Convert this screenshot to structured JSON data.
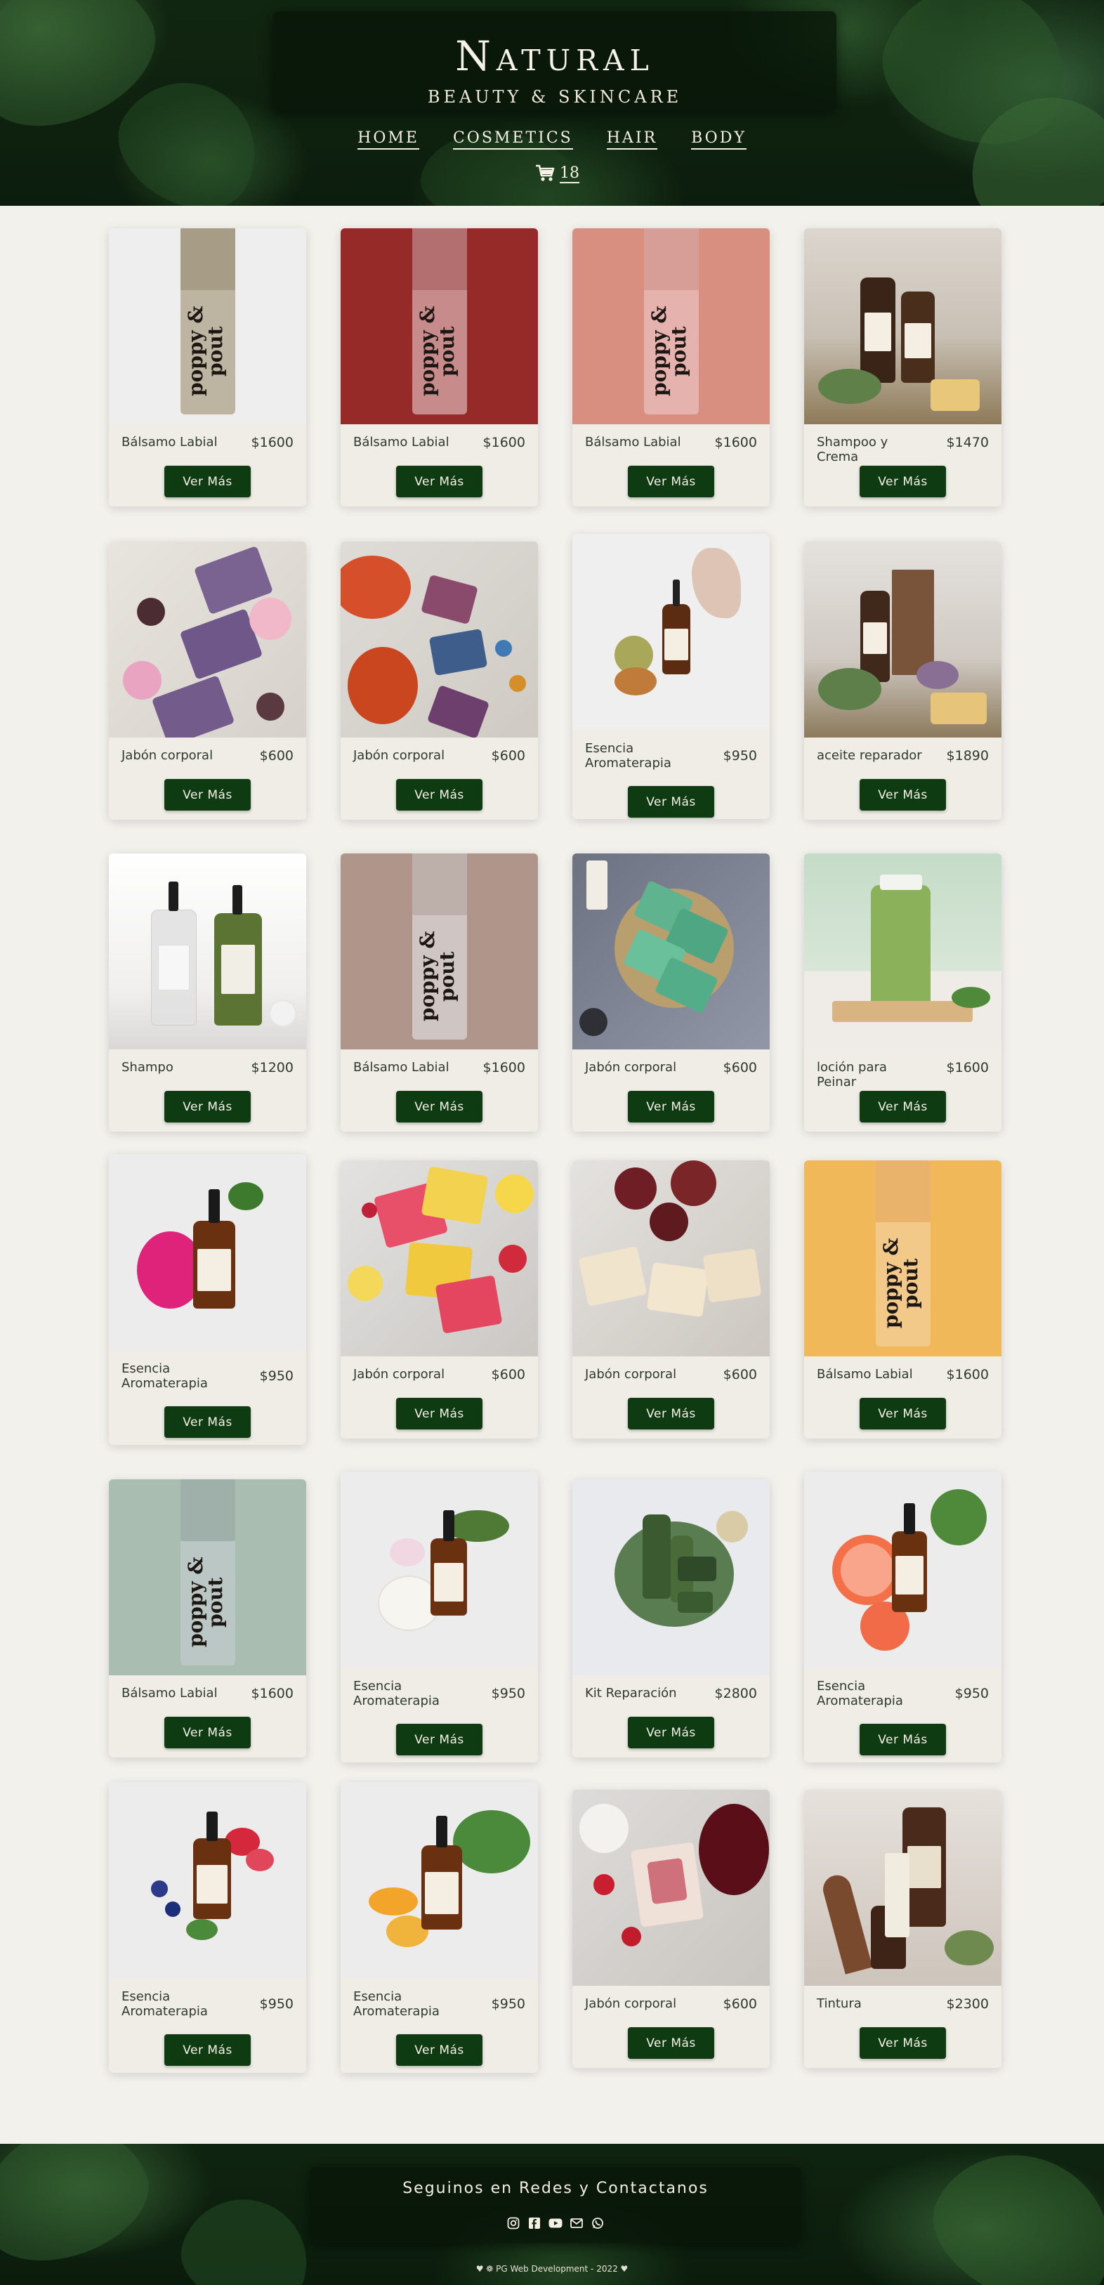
{
  "brand": {
    "title": "Natural",
    "subtitle": "Beauty & Skincare"
  },
  "nav": [
    "Home",
    "Cosmetics",
    "Hair",
    "Body"
  ],
  "cart": {
    "count": "18"
  },
  "button_label": "Ver Más",
  "products": [
    {
      "name": "Bálsamo Labial",
      "price": "$1600"
    },
    {
      "name": "Bálsamo Labial",
      "price": "$1600"
    },
    {
      "name": "Bálsamo Labial",
      "price": "$1600"
    },
    {
      "name": "Shampoo y Crema",
      "price": "$1470"
    },
    {
      "name": "Jabón corporal",
      "price": "$600"
    },
    {
      "name": "Jabón corporal",
      "price": "$600"
    },
    {
      "name": "Esencia Aromaterapia",
      "price": "$950"
    },
    {
      "name": "aceite reparador",
      "price": "$1890"
    },
    {
      "name": "Shampo",
      "price": "$1200"
    },
    {
      "name": "Bálsamo Labial",
      "price": "$1600"
    },
    {
      "name": "Jabón corporal",
      "price": "$600"
    },
    {
      "name": "loción para Peinar",
      "price": "$1600"
    },
    {
      "name": "Esencia Aromaterapia",
      "price": "$950"
    },
    {
      "name": "Jabón corporal",
      "price": "$600"
    },
    {
      "name": "Jabón corporal",
      "price": "$600"
    },
    {
      "name": "Bálsamo Labial",
      "price": "$1600"
    },
    {
      "name": "Bálsamo Labial",
      "price": "$1600"
    },
    {
      "name": "Esencia Aromaterapia",
      "price": "$950"
    },
    {
      "name": "Kit Reparación",
      "price": "$2800"
    },
    {
      "name": "Esencia Aromaterapia",
      "price": "$950"
    },
    {
      "name": "Esencia Aromaterapia",
      "price": "$950"
    },
    {
      "name": "Esencia Aromaterapia",
      "price": "$950"
    },
    {
      "name": "Jabón corporal",
      "price": "$600"
    },
    {
      "name": "Tintura",
      "price": "$2300"
    }
  ],
  "tube_brand": "poppy & pout",
  "footer": {
    "title": "Seguinos en Redes y Contactanos",
    "credit": "♥ ❁ PG Web Development - 2022 ♥"
  },
  "colors": {
    "accent": "#0f3b12",
    "page_bg": "#f3f1ec",
    "card_bg": "#f0ede6"
  }
}
